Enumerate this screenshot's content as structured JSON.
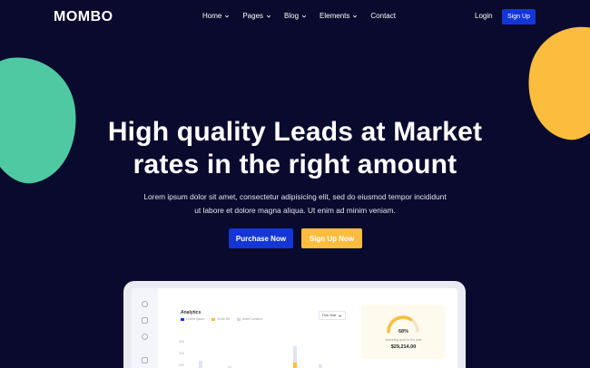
{
  "brand": {
    "name": "MOMBO"
  },
  "nav": {
    "items": [
      {
        "label": "Home",
        "has_dropdown": true
      },
      {
        "label": "Pages",
        "has_dropdown": true
      },
      {
        "label": "Blog",
        "has_dropdown": true
      },
      {
        "label": "Elements",
        "has_dropdown": true
      },
      {
        "label": "Contact",
        "has_dropdown": false
      }
    ],
    "login_label": "Login",
    "signup_label": "Sign Up"
  },
  "hero": {
    "title_line1": "High quality Leads at Market",
    "title_line2": "rates in the right amount",
    "subtitle_line1": "Lorem ipsum dolor sit amet, consectetur adipisicing elit, sed do eiusmod tempor incididunt",
    "subtitle_line2": "ut labore et dolore magna aliqua. Ut enim ad minim veniam.",
    "purchase_label": "Purchase Now",
    "signup_now_label": "Sign Up Now"
  },
  "dashboard": {
    "panel_title": "Analytics",
    "legend": [
      {
        "label": "Lorem Ipsum",
        "color": "#1436d6"
      },
      {
        "label": "Dolor Sit",
        "color": "#fcbd3e"
      },
      {
        "label": "Amet Consect",
        "color": "#d0d3de"
      }
    ],
    "range_select": "This Year",
    "y_ticks": [
      "300",
      "200",
      "100"
    ],
    "stat": {
      "percent": "68%",
      "percent_value": 68,
      "caption": "Marketing goal for the year",
      "amount": "$29,214.00"
    }
  },
  "colors": {
    "background": "#0a0a2e",
    "primary": "#1436d6",
    "accent": "#fcbd3e",
    "mint": "#4fc9a1"
  }
}
